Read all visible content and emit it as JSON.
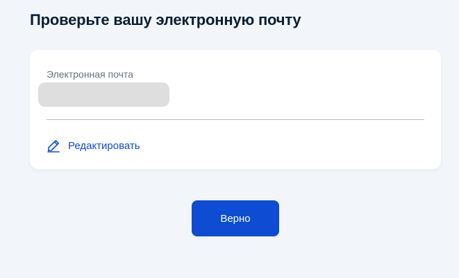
{
  "page": {
    "title": "Проверьте вашу электронную почту"
  },
  "email_card": {
    "label": "Электронная почта",
    "value_masked": true,
    "edit_label": "Редактировать",
    "edit_icon": "pencil-icon"
  },
  "actions": {
    "confirm_label": "Верно"
  },
  "colors": {
    "background": "#f2f5fa",
    "card": "#ffffff",
    "accent": "#0d4cd3",
    "title": "#0b1f33",
    "label": "#66727f",
    "divider": "#b3bac3",
    "mask": "#dedede"
  }
}
